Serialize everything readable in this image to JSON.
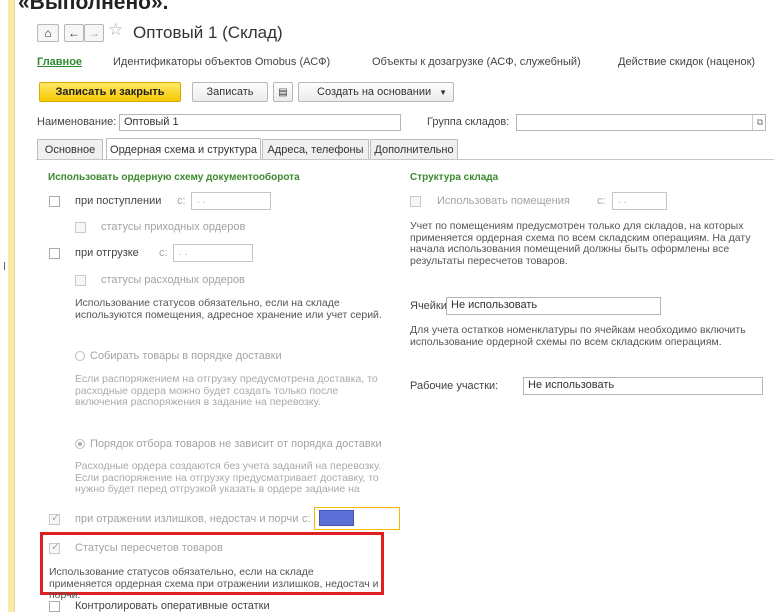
{
  "page": {
    "cut_heading": "«Выполнено»."
  },
  "window": {
    "title": "Оптовый 1 (Склад)"
  },
  "nav": {
    "main": "Главное",
    "links": [
      "Идентификаторы объектов Omobus (АСФ)",
      "Объекты к дозагрузке (АСФ, служебный)",
      "Действие скидок (наценок)"
    ]
  },
  "toolbar": {
    "save_close": "Записать и закрыть",
    "save": "Записать",
    "create_basis": "Создать на основании"
  },
  "fields": {
    "name_label": "Наименование:",
    "name_value": "Оптовый 1",
    "group_label": "Группа складов:",
    "group_value": ""
  },
  "tabs": [
    "Основное",
    "Ордерная схема и структура",
    "Адреса, телефоны",
    "Дополнительно"
  ],
  "left": {
    "section_title": "Использовать ордерную схему документооборота",
    "on_receipt": "при поступлении",
    "from_label": "с:",
    "date_placeholder": " .  . ",
    "incoming_statuses": "статусы приходных ордеров",
    "on_shipment": "при отгрузке",
    "outgoing_statuses": "статусы расходных ордеров",
    "note1": "Использование статусов обязательно, если на складе используются помещения, адресное хранение или учет серий.",
    "radio1": "Собирать товары в порядке доставки",
    "radio1_note": "Если распоряжением на отгрузку предусмотрена доставка, то расходные ордера можно будет создать только после включения распоряжения в задание на перевозку.",
    "radio2": "Порядок отбора товаров не зависит от порядка доставки",
    "radio2_note": "Расходные ордера создаются без учета заданий на перевозку. Если распоряжение на отгрузку предусматривает доставку, то нужно будет перед отгрузкой указать в ордере задание на",
    "on_surplus": "при отражении излишков, недостач и порчи",
    "recount_statuses": "Статусы пересчетов товаров",
    "note2": "Использование статусов обязательно, если на складе применяется ордерная схема при отражении излишков, недостач и порчи.",
    "operational": "Контролировать оперативные остатки"
  },
  "right": {
    "section_title": "Структура склада",
    "use_rooms": "Использовать помещения",
    "from_label": "с:",
    "date_placeholder": " .  . ",
    "rooms_note": "Учет по помещениям предусмотрен только для складов, на которых применяется ордерная схема по всем складским операциям. На дату начала использования помещений должны быть оформлены все результаты пересчетов товаров.",
    "cells_label": "Ячейки:",
    "cells_value": "Не использовать",
    "cells_note": "Для учета остатков номенклатуры по ячейкам необходимо включить использование ордерной схемы по всем складским операциям.",
    "work_areas_label": "Рабочие участки:",
    "work_areas_value": "Не использовать"
  },
  "colors": {
    "highlight_red": "#e02020",
    "highlight_orange": "#f5b800",
    "selection_blue": "#5b6fd6",
    "section_green": "#3c8a2e"
  }
}
